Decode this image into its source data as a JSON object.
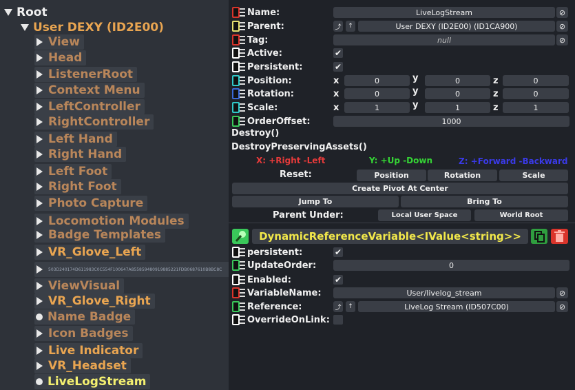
{
  "hierarchy": {
    "root": "Root",
    "user": "User DEXY (ID2E00)",
    "items": [
      {
        "label": "View",
        "color": "brown",
        "icon": "expand-arrow-icon"
      },
      {
        "label": "Head",
        "color": "brown",
        "icon": "expand-arrow-icon"
      },
      {
        "label": "ListenerRoot",
        "color": "brown",
        "icon": "expand-arrow-icon"
      },
      {
        "label": "Context Menu",
        "color": "brown",
        "icon": "expand-arrow-icon"
      },
      {
        "label": "LeftController",
        "color": "brown",
        "icon": "expand-arrow-icon"
      },
      {
        "label": "RightController",
        "color": "brown",
        "icon": "expand-arrow-icon"
      },
      {
        "label": "Left Hand",
        "color": "brown",
        "icon": "expand-arrow-icon"
      },
      {
        "label": "Right Hand",
        "color": "brown",
        "icon": "expand-arrow-icon"
      },
      {
        "label": "Left Foot",
        "color": "brown",
        "icon": "expand-arrow-icon"
      },
      {
        "label": "Right Foot",
        "color": "brown",
        "icon": "expand-arrow-icon"
      },
      {
        "label": "Photo Capture",
        "color": "brown",
        "icon": "expand-arrow-icon"
      },
      {
        "label": "Locomotion Modules",
        "color": "brown",
        "icon": "expand-arrow-icon"
      },
      {
        "label": "Badge Templates",
        "color": "brown",
        "icon": "expand-arrow-icon"
      },
      {
        "label": "VR_Glove_Left",
        "color": "orange",
        "icon": "expand-arrow-icon"
      },
      {
        "label": "503D240174D611983C0C554F100647A855859480919885221FDB0687610B8BC8C",
        "color": "tiny",
        "icon": "expand-arrow-icon"
      },
      {
        "label": "ViewVisual",
        "color": "brown",
        "icon": "expand-arrow-icon"
      },
      {
        "label": "VR_Glove_Right",
        "color": "orange",
        "icon": "expand-arrow-icon"
      },
      {
        "label": "Name Badge",
        "color": "brown",
        "icon": "leaf-dot-icon"
      },
      {
        "label": "Icon Badges",
        "color": "brown",
        "icon": "expand-arrow-icon"
      },
      {
        "label": "Live Indicator",
        "color": "orange",
        "icon": "expand-arrow-icon"
      },
      {
        "label": "VR_Headset",
        "color": "orange",
        "icon": "expand-arrow-icon"
      },
      {
        "label": "LiveLogStream",
        "color": "yellow",
        "icon": "leaf-dot-icon"
      }
    ]
  },
  "slot": {
    "name_label": "Name:",
    "name_value": "LiveLogStream",
    "parent_label": "Parent:",
    "parent_value": "User DEXY (ID2E00) (ID1CA900)",
    "tag_label": "Tag:",
    "tag_value": "null",
    "active_label": "Active:",
    "active_check": "✔",
    "persistent_label": "Persistent:",
    "persistent_check": "✔",
    "position_label": "Position:",
    "position": {
      "x": "0",
      "y": "0",
      "z": "0"
    },
    "rotation_label": "Rotation:",
    "rotation": {
      "x": "0",
      "y": "0",
      "z": "0"
    },
    "scale_label": "Scale:",
    "scale": {
      "x": "1",
      "y": "1",
      "z": "1"
    },
    "orderoffset_label": "OrderOffset:",
    "orderoffset_value": "1000",
    "destroy": "Destroy()",
    "destroy_preserving": "DestroyPreservingAssets()",
    "hint_x": "X: +Right -Left",
    "hint_y": "Y: +Up -Down",
    "hint_z": "Z: +Forward -Backward",
    "reset_label": "Reset:",
    "reset_position": "Position",
    "reset_rotation": "Rotation",
    "reset_scale": "Scale",
    "create_pivot": "Create Pivot At Center",
    "jump_to": "Jump To",
    "bring_to": "Bring To",
    "parent_under_label": "Parent Under:",
    "local_user_space": "Local User Space",
    "world_root": "World Root",
    "null_glyph": "⊘",
    "axis_x": "x",
    "axis_y": "y",
    "axis_z": "z",
    "btn_up": "↑",
    "btn_parent": "⤴"
  },
  "component": {
    "title": "DynamicReferenceVariable<IValue<string>>",
    "persistent_label": "persistent:",
    "persistent_check": "✔",
    "updateorder_label": "UpdateOrder:",
    "updateorder_value": "0",
    "enabled_label": "Enabled:",
    "enabled_check": "✔",
    "variablename_label": "VariableName:",
    "variablename_value": "User/livelog_stream",
    "reference_label": "Reference:",
    "reference_value": "LiveLog Stream  (ID507C00)",
    "overrideonlink_label": "OverrideOnLink:"
  },
  "colors": {
    "field_red": "#d9342b",
    "field_yellow": "#e8e070",
    "field_white": "#ffffff",
    "field_cyan": "#30c8c8",
    "field_blue": "#3a6ad8",
    "field_green": "#3ac85a",
    "hint_x": "#e53a3a",
    "hint_y": "#35d435",
    "hint_z": "#3a3ae8",
    "component_title": "#f2e84a",
    "duplicate": "#2f9e3f",
    "delete": "#d9342b"
  }
}
